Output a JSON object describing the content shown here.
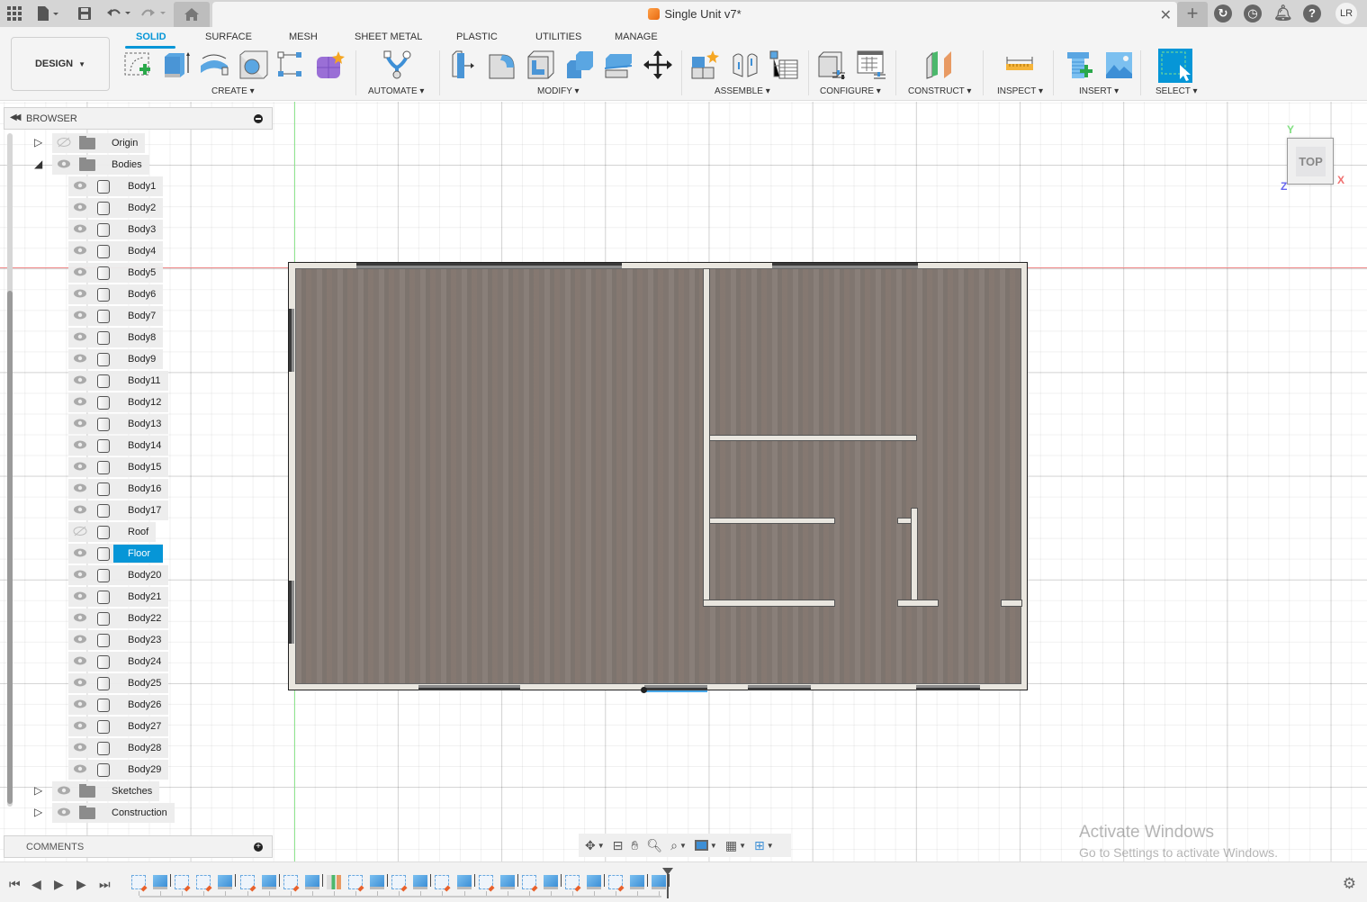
{
  "app": {
    "document_title": "Single Unit v7*",
    "user_initials": "LR"
  },
  "quick_access": {
    "icons": [
      "grid-menu-icon",
      "file-icon",
      "save-icon",
      "undo-icon",
      "redo-icon",
      "home-icon"
    ]
  },
  "header_icons": [
    "new-tab-icon",
    "extensions-icon",
    "job-status-icon",
    "notifications-icon",
    "help-icon"
  ],
  "toolbar": {
    "workspace_label": "DESIGN",
    "tabs": [
      {
        "label": "SOLID",
        "active": true
      },
      {
        "label": "SURFACE",
        "active": false
      },
      {
        "label": "MESH",
        "active": false
      },
      {
        "label": "SHEET METAL",
        "active": false
      },
      {
        "label": "PLASTIC",
        "active": false
      },
      {
        "label": "UTILITIES",
        "active": false
      },
      {
        "label": "MANAGE",
        "active": false
      }
    ],
    "groups": [
      {
        "label": "CREATE",
        "tools": [
          "create-sketch",
          "extrude",
          "revolve",
          "hole",
          "pattern",
          "create-form"
        ]
      },
      {
        "label": "AUTOMATE",
        "tools": [
          "automate"
        ]
      },
      {
        "label": "MODIFY",
        "tools": [
          "press-pull",
          "fillet",
          "shell",
          "combine",
          "offset-face",
          "move-copy"
        ]
      },
      {
        "label": "ASSEMBLE",
        "tools": [
          "new-component",
          "joint",
          "bill-of-materials"
        ]
      },
      {
        "label": "CONFIGURE",
        "tools": [
          "configure",
          "configuration-table"
        ]
      },
      {
        "label": "CONSTRUCT",
        "tools": [
          "offset-plane"
        ]
      },
      {
        "label": "INSPECT",
        "tools": [
          "measure"
        ]
      },
      {
        "label": "INSERT",
        "tools": [
          "insert-mcmaster",
          "insert-canvas"
        ]
      },
      {
        "label": "SELECT",
        "tools": [
          "select"
        ]
      }
    ]
  },
  "browser": {
    "title": "BROWSER",
    "folders_top": [
      {
        "label": "Origin",
        "visible": false,
        "expanded": false
      },
      {
        "label": "Bodies",
        "visible": true,
        "expanded": true
      }
    ],
    "bodies": [
      {
        "label": "Body1",
        "visible": true
      },
      {
        "label": "Body2",
        "visible": true
      },
      {
        "label": "Body3",
        "visible": true
      },
      {
        "label": "Body4",
        "visible": true
      },
      {
        "label": "Body5",
        "visible": true
      },
      {
        "label": "Body6",
        "visible": true
      },
      {
        "label": "Body7",
        "visible": true
      },
      {
        "label": "Body8",
        "visible": true
      },
      {
        "label": "Body9",
        "visible": true
      },
      {
        "label": "Body11",
        "visible": true
      },
      {
        "label": "Body12",
        "visible": true
      },
      {
        "label": "Body13",
        "visible": true
      },
      {
        "label": "Body14",
        "visible": true
      },
      {
        "label": "Body15",
        "visible": true
      },
      {
        "label": "Body16",
        "visible": true
      },
      {
        "label": "Body17",
        "visible": true
      },
      {
        "label": "Roof",
        "visible": false
      },
      {
        "label": "Floor",
        "visible": true,
        "selected": true
      },
      {
        "label": "Body20",
        "visible": true
      },
      {
        "label": "Body21",
        "visible": true
      },
      {
        "label": "Body22",
        "visible": true
      },
      {
        "label": "Body23",
        "visible": true
      },
      {
        "label": "Body24",
        "visible": true
      },
      {
        "label": "Body25",
        "visible": true
      },
      {
        "label": "Body26",
        "visible": true
      },
      {
        "label": "Body27",
        "visible": true
      },
      {
        "label": "Body28",
        "visible": true
      },
      {
        "label": "Body29",
        "visible": true
      }
    ],
    "folders_bottom": [
      {
        "label": "Sketches",
        "visible": true,
        "expanded": false
      },
      {
        "label": "Construction",
        "visible": true,
        "expanded": false
      }
    ]
  },
  "comments": {
    "title": "COMMENTS"
  },
  "viewcube": {
    "face": "TOP",
    "axis_x": "X",
    "axis_y": "Y",
    "axis_z": "Z"
  },
  "nav_bar": {
    "tools": [
      "orbit-icon",
      "look-at-icon",
      "pan-icon",
      "zoom-icon",
      "fit-icon",
      "display-settings-icon",
      "grid-settings-icon",
      "viewports-icon"
    ]
  },
  "watermark": {
    "line1": "Activate Windows",
    "line2": "Go to Settings to activate Windows."
  },
  "timeline": {
    "controls": [
      "go-to-start",
      "step-back",
      "play",
      "step-forward",
      "go-to-end"
    ],
    "features": [
      "sketch",
      "extrude",
      "sketch",
      "sketch",
      "extrude",
      "sketch",
      "extrude",
      "sketch",
      "extrude",
      "construct",
      "sketch",
      "extrude",
      "sketch",
      "extrude",
      "sketch",
      "extrude",
      "sketch",
      "extrude",
      "sketch",
      "extrude",
      "sketch",
      "extrude",
      "sketch",
      "extrude",
      "extrude"
    ]
  },
  "colors": {
    "accent": "#0696d7",
    "floor": "#847a74",
    "wall": "#e9e6df",
    "x_axis": "#f08a8a",
    "y_axis": "#8fe68f"
  }
}
